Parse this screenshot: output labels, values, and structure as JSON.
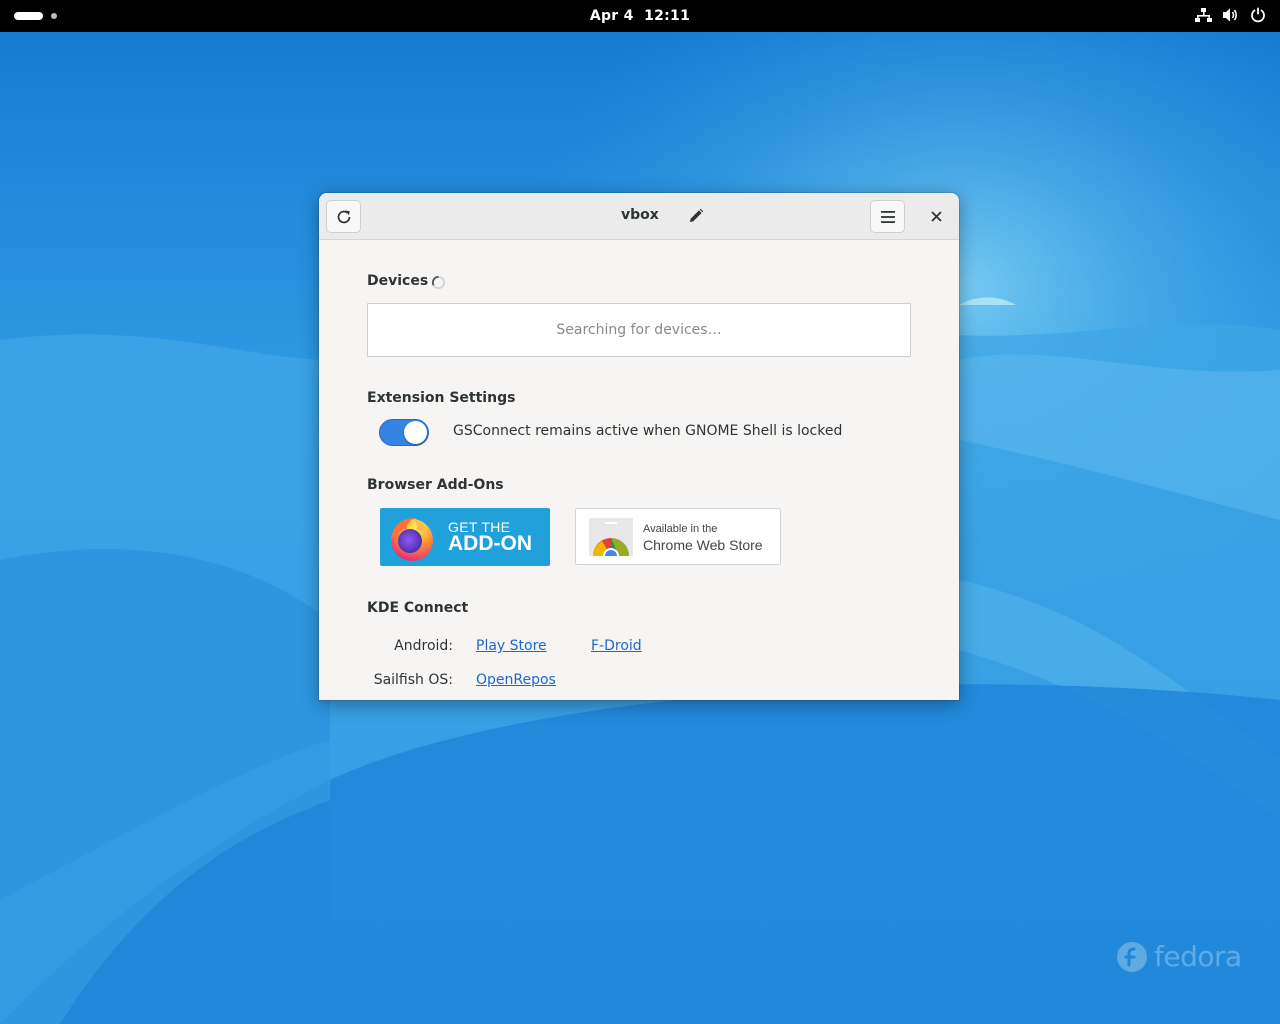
{
  "topbar": {
    "date": "Apr 4",
    "time": "12:11",
    "tray_icons": [
      "network-icon",
      "volume-icon",
      "power-icon"
    ]
  },
  "window": {
    "title": "vbox",
    "devices": {
      "heading": "Devices",
      "placeholder": "Searching for devices…"
    },
    "extension_settings": {
      "heading": "Extension Settings",
      "toggle_label": "GSConnect remains active when GNOME Shell is locked",
      "toggle_on": true
    },
    "browser_addons": {
      "heading": "Browser Add-Ons",
      "firefox_line1": "GET THE",
      "firefox_line2": "ADD-ON",
      "chrome_line1": "Available in the",
      "chrome_line2": "Chrome Web Store"
    },
    "kde_connect": {
      "heading": "KDE Connect",
      "android_label": "Android:",
      "android_links": [
        "Play Store",
        "F-Droid"
      ],
      "sailfish_label": "Sailfish OS:",
      "sailfish_links": [
        "OpenRepos"
      ]
    }
  },
  "desktop": {
    "watermark": "fedora"
  },
  "colors": {
    "accent": "#3584e4",
    "link": "#1b6acb",
    "wallpaper": "#1a7fd1"
  }
}
